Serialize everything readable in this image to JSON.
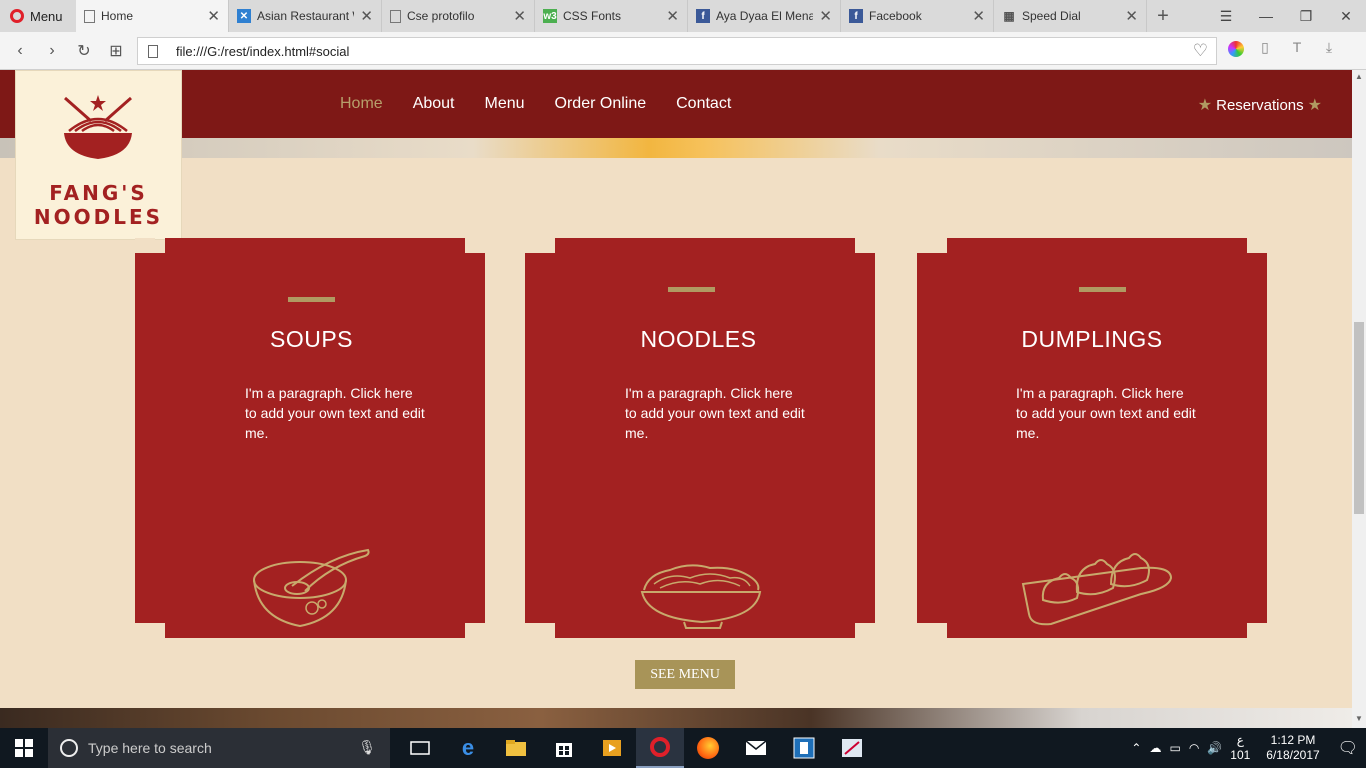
{
  "browser": {
    "menu_label": "Menu",
    "tabs": [
      {
        "title": "Home",
        "favicon": "page-icon",
        "active": true
      },
      {
        "title": "Asian Restaurant W",
        "favicon": "wix-icon"
      },
      {
        "title": "Cse protofilo",
        "favicon": "page-icon"
      },
      {
        "title": "CSS Fonts",
        "favicon": "w3schools-icon"
      },
      {
        "title": "Aya Dyaa El Menaw",
        "favicon": "facebook-icon"
      },
      {
        "title": "Facebook",
        "favicon": "facebook-icon"
      },
      {
        "title": "Speed Dial",
        "favicon": "speed-dial-icon"
      }
    ],
    "url": "file:///G:/rest/index.html#social"
  },
  "site": {
    "logo_line1": "FANG'S",
    "logo_line2": "NOODLES",
    "nav": [
      "Home",
      "About",
      "Menu",
      "Order Online",
      "Contact"
    ],
    "reservations": "Reservations",
    "cards": [
      {
        "title": "SOUPS",
        "text": "I'm a paragraph. Click here to add your own text and edit me.",
        "icon": "soup-bowl-icon"
      },
      {
        "title": "NOODLES",
        "text": "I'm a paragraph. Click here to add your own text and edit me.",
        "icon": "noodle-bowl-icon"
      },
      {
        "title": "DUMPLINGS",
        "text": "I'm a paragraph. Click here to add your own text and edit me.",
        "icon": "dumplings-icon"
      }
    ],
    "see_menu": "SEE MENU",
    "colors": {
      "nav_bg": "#7e1816",
      "card_bg": "#a32121",
      "accent_gold": "#b09a62",
      "page_bg": "#f1dfc5"
    }
  },
  "taskbar": {
    "search_placeholder": "Type here to search",
    "lang_top": "ع",
    "lang_bottom": "101",
    "time": "1:12 PM",
    "date": "6/18/2017"
  }
}
